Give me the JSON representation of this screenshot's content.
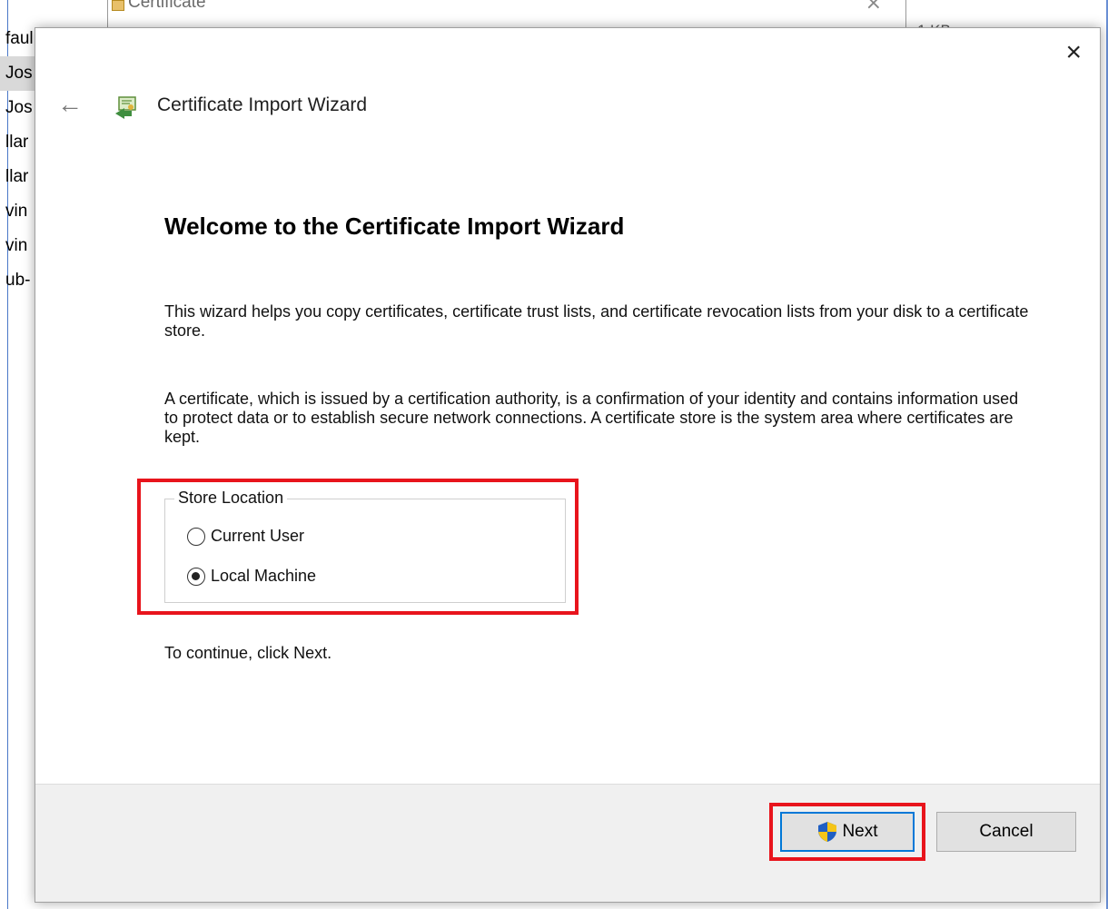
{
  "background": {
    "list_rows": [
      "faul",
      "Jos",
      "Jos",
      "llar",
      "llar",
      "vin",
      "vin",
      "ub-"
    ],
    "cert_window_title": "Certificate",
    "size_text": "1 KB"
  },
  "dialog": {
    "close_glyph": "×",
    "back_glyph": "←",
    "title": "Certificate Import Wizard",
    "heading": "Welcome to the Certificate Import Wizard",
    "paragraph1": "This wizard helps you copy certificates, certificate trust lists, and certificate revocation lists from your disk to a certificate store.",
    "paragraph2": "A certificate, which is issued by a certification authority, is a confirmation of your identity and contains information used to protect data or to establish secure network connections. A certificate store is the system area where certificates are kept.",
    "store_location": {
      "legend": "Store Location",
      "options": [
        "Current User",
        "Local Machine"
      ],
      "selected": "Local Machine"
    },
    "continue_text": "To continue, click Next.",
    "buttons": {
      "next": "Next",
      "cancel": "Cancel"
    }
  },
  "colors": {
    "highlight": "#e8141c",
    "default_button_border": "#0078d7",
    "footer_bg": "#f0f0f0"
  },
  "icons": {
    "wizard": "certificate-wizard-icon",
    "next": "uac-shield-icon"
  }
}
